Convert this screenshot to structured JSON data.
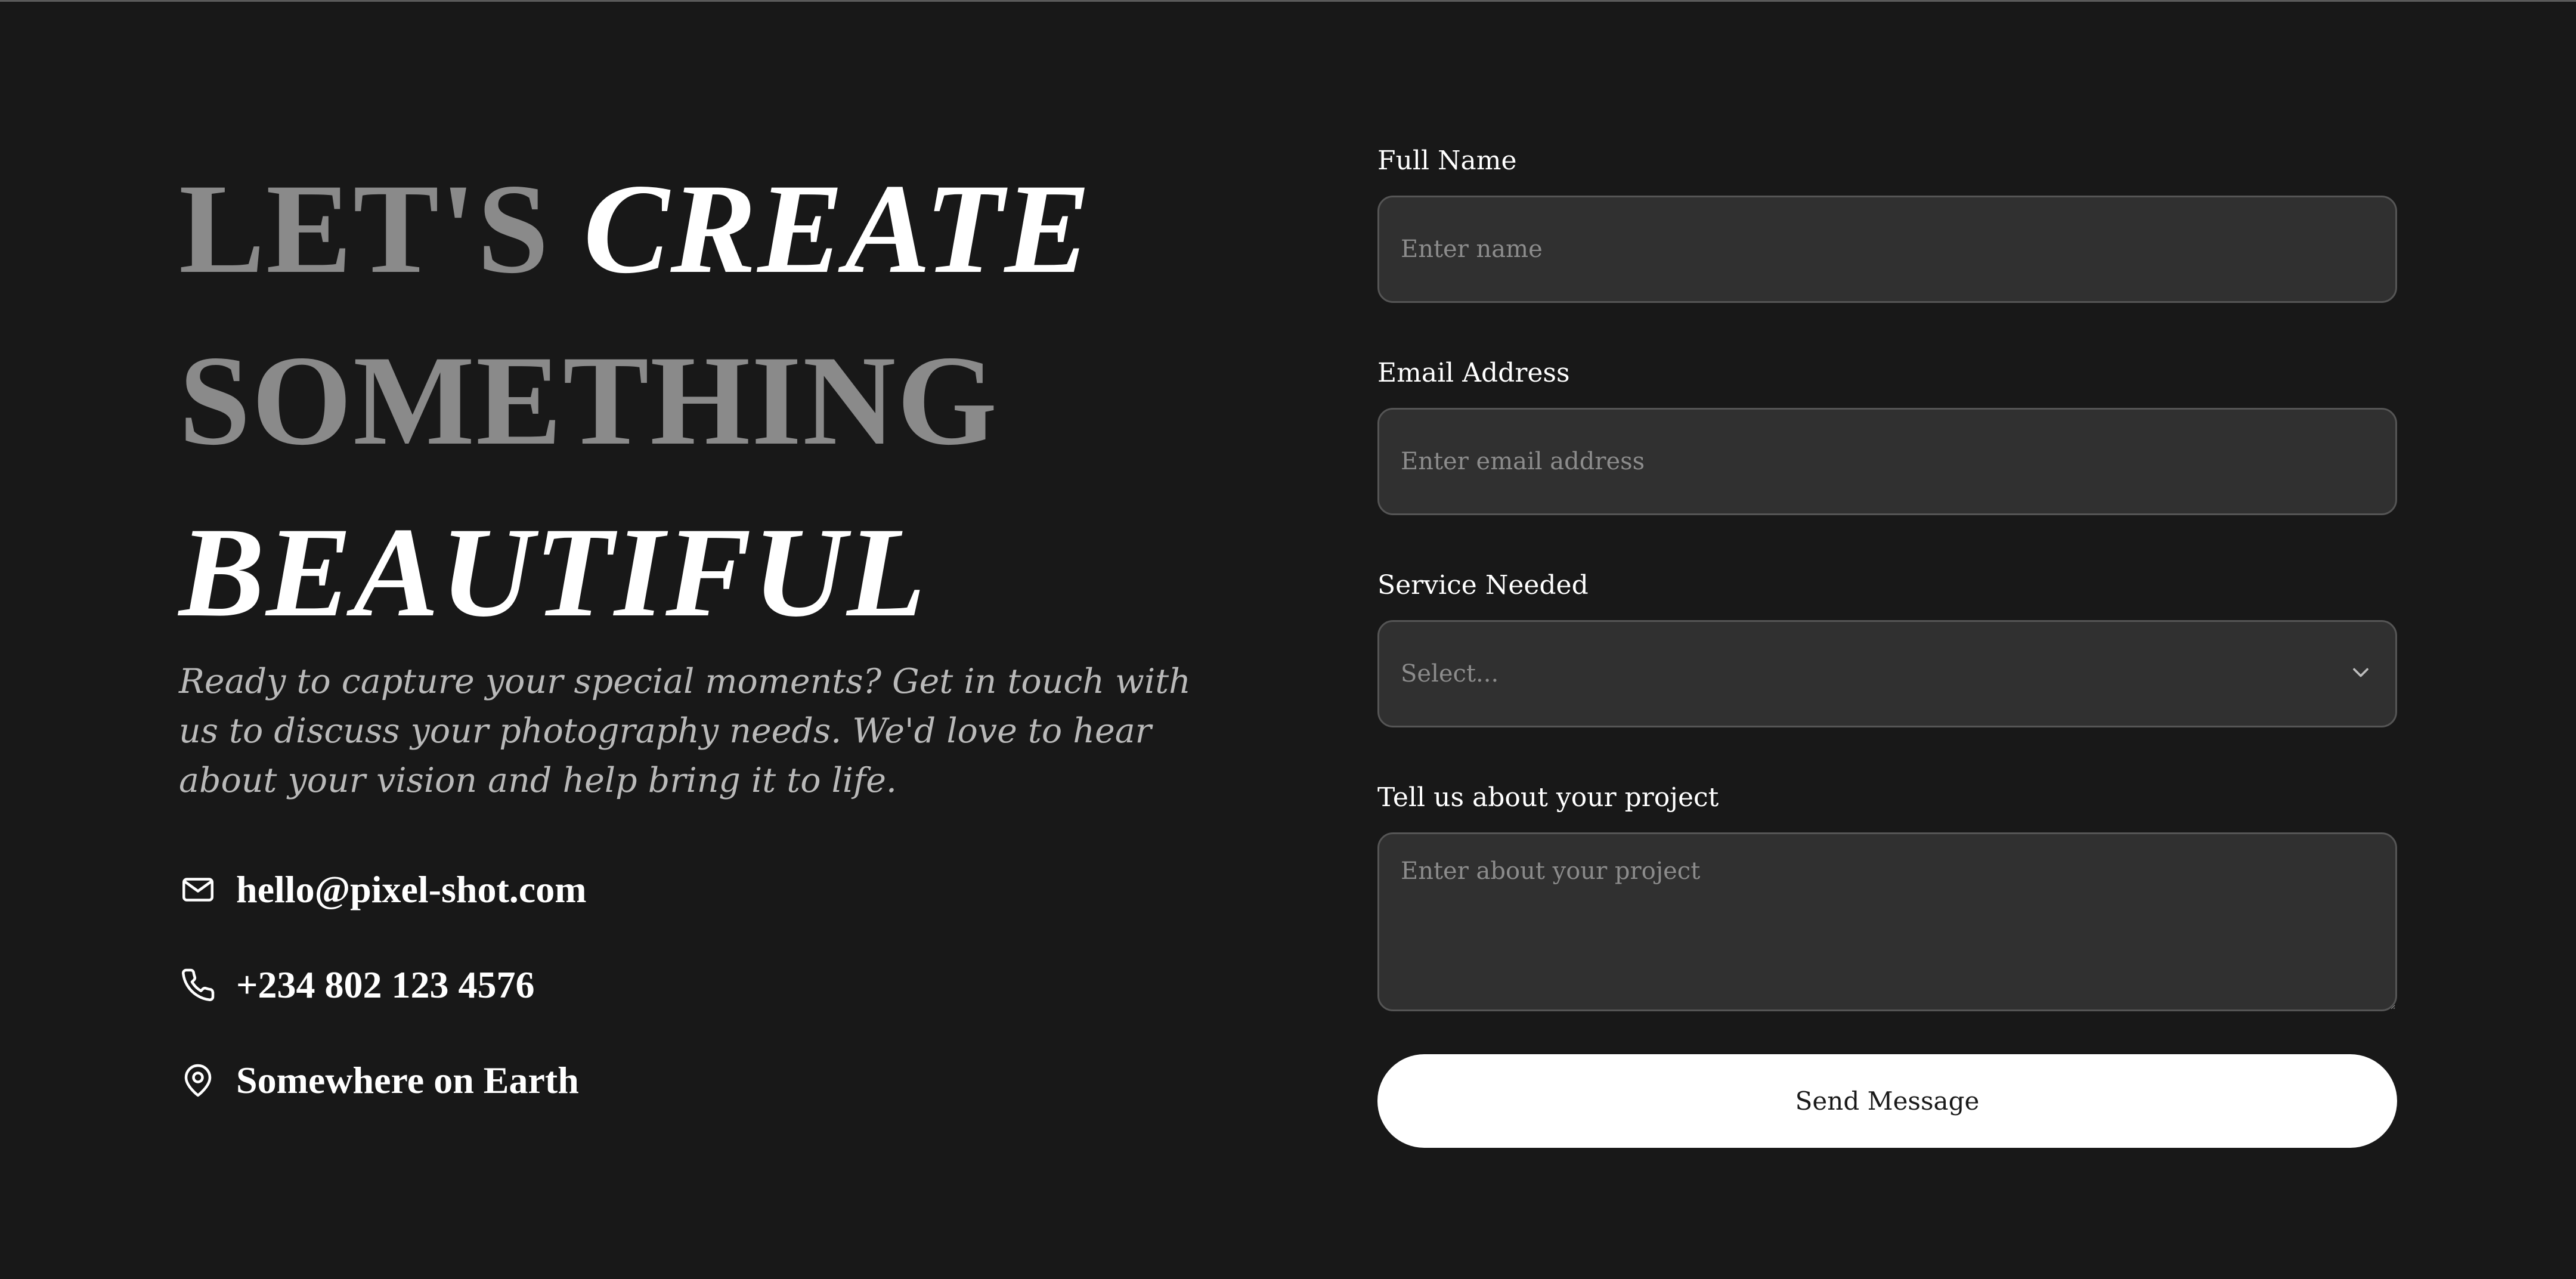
{
  "hero": {
    "line1_muted": "LET'S",
    "line1_bright": "CREATE",
    "line2_muted": "SOMETHING",
    "line3_bright": "BEAUTIFUL",
    "lead": "Ready to capture your special moments? Get in touch with us to discuss your photography needs. We'd love to hear about your vision and help bring it to life."
  },
  "contacts": [
    {
      "icon": "mail-icon",
      "text": "hello@pixel-shot.com"
    },
    {
      "icon": "phone-icon",
      "text": "+234 802 123 4576"
    },
    {
      "icon": "location-pin-icon",
      "text": "Somewhere on Earth"
    }
  ],
  "form": {
    "name": {
      "label": "Full Name",
      "placeholder": "Enter name"
    },
    "email": {
      "label": "Email Address",
      "placeholder": "Enter email address"
    },
    "service": {
      "label": "Service Needed",
      "selected": "Select..."
    },
    "project": {
      "label": "Tell us about your project",
      "placeholder": "Enter about your project"
    },
    "submit_label": "Send Message"
  },
  "colors": {
    "background": "#181818",
    "muted_heading": "#8a8a8a",
    "field_bg": "#303030",
    "field_border": "#555555",
    "button_bg": "#ffffff"
  }
}
